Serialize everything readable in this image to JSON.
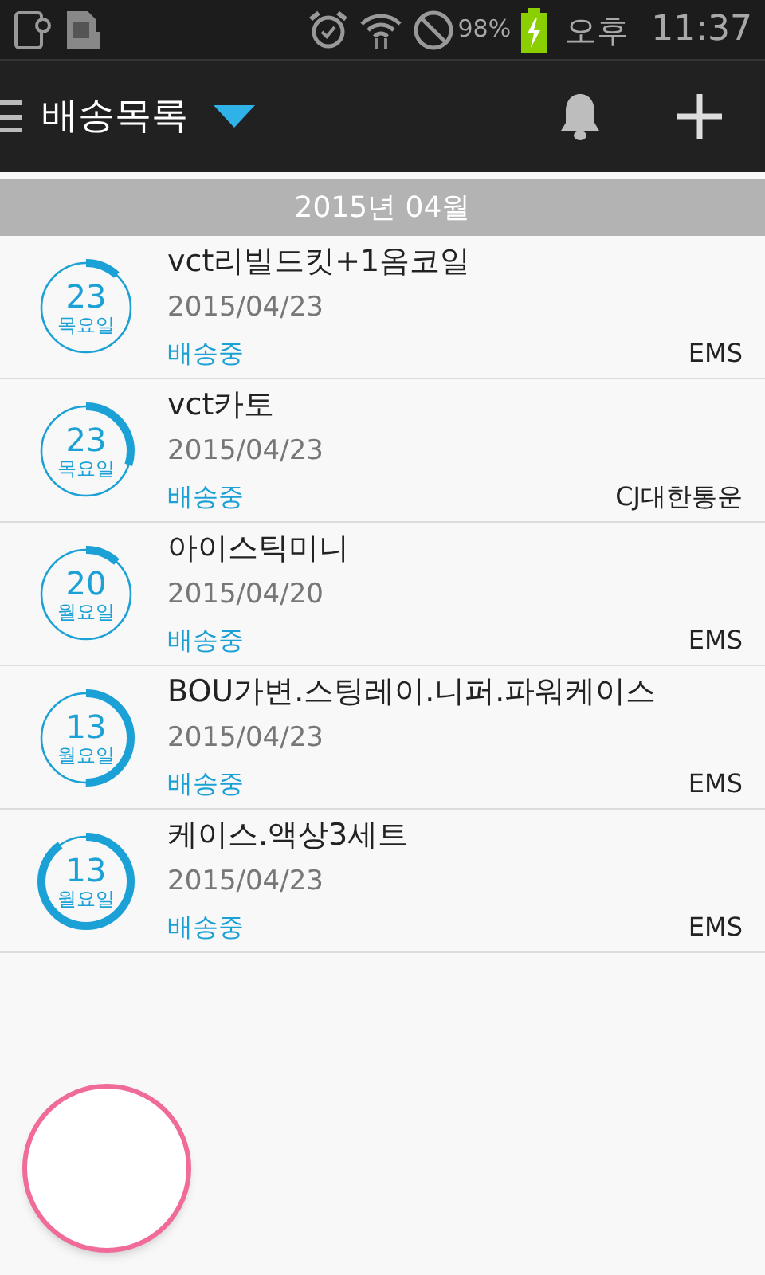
{
  "status_bar": {
    "battery": "98%",
    "ampm": "오후",
    "time": "11:37"
  },
  "toolbar": {
    "title": "배송목록"
  },
  "month_header": "2015년 04월",
  "orders": [
    {
      "day": "23",
      "weekday": "목요일",
      "name": "vct리빌드킷+1옴코일",
      "date": "2015/04/23",
      "status": "배송중",
      "carrier": "EMS"
    },
    {
      "day": "23",
      "weekday": "목요일",
      "name": "vct카토",
      "date": "2015/04/23",
      "status": "배송중",
      "carrier": "CJ대한통운"
    },
    {
      "day": "20",
      "weekday": "월요일",
      "name": "아이스틱미니",
      "date": "2015/04/20",
      "status": "배송중",
      "carrier": "EMS"
    },
    {
      "day": "13",
      "weekday": "월요일",
      "name": "BOU가변.스팅레이.니퍼.파워케이스",
      "date": "2015/04/23",
      "status": "배송중",
      "carrier": "EMS"
    },
    {
      "day": "13",
      "weekday": "월요일",
      "name": "케이스.액상3세트",
      "date": "2015/04/23",
      "status": "배송중",
      "carrier": "EMS"
    }
  ]
}
